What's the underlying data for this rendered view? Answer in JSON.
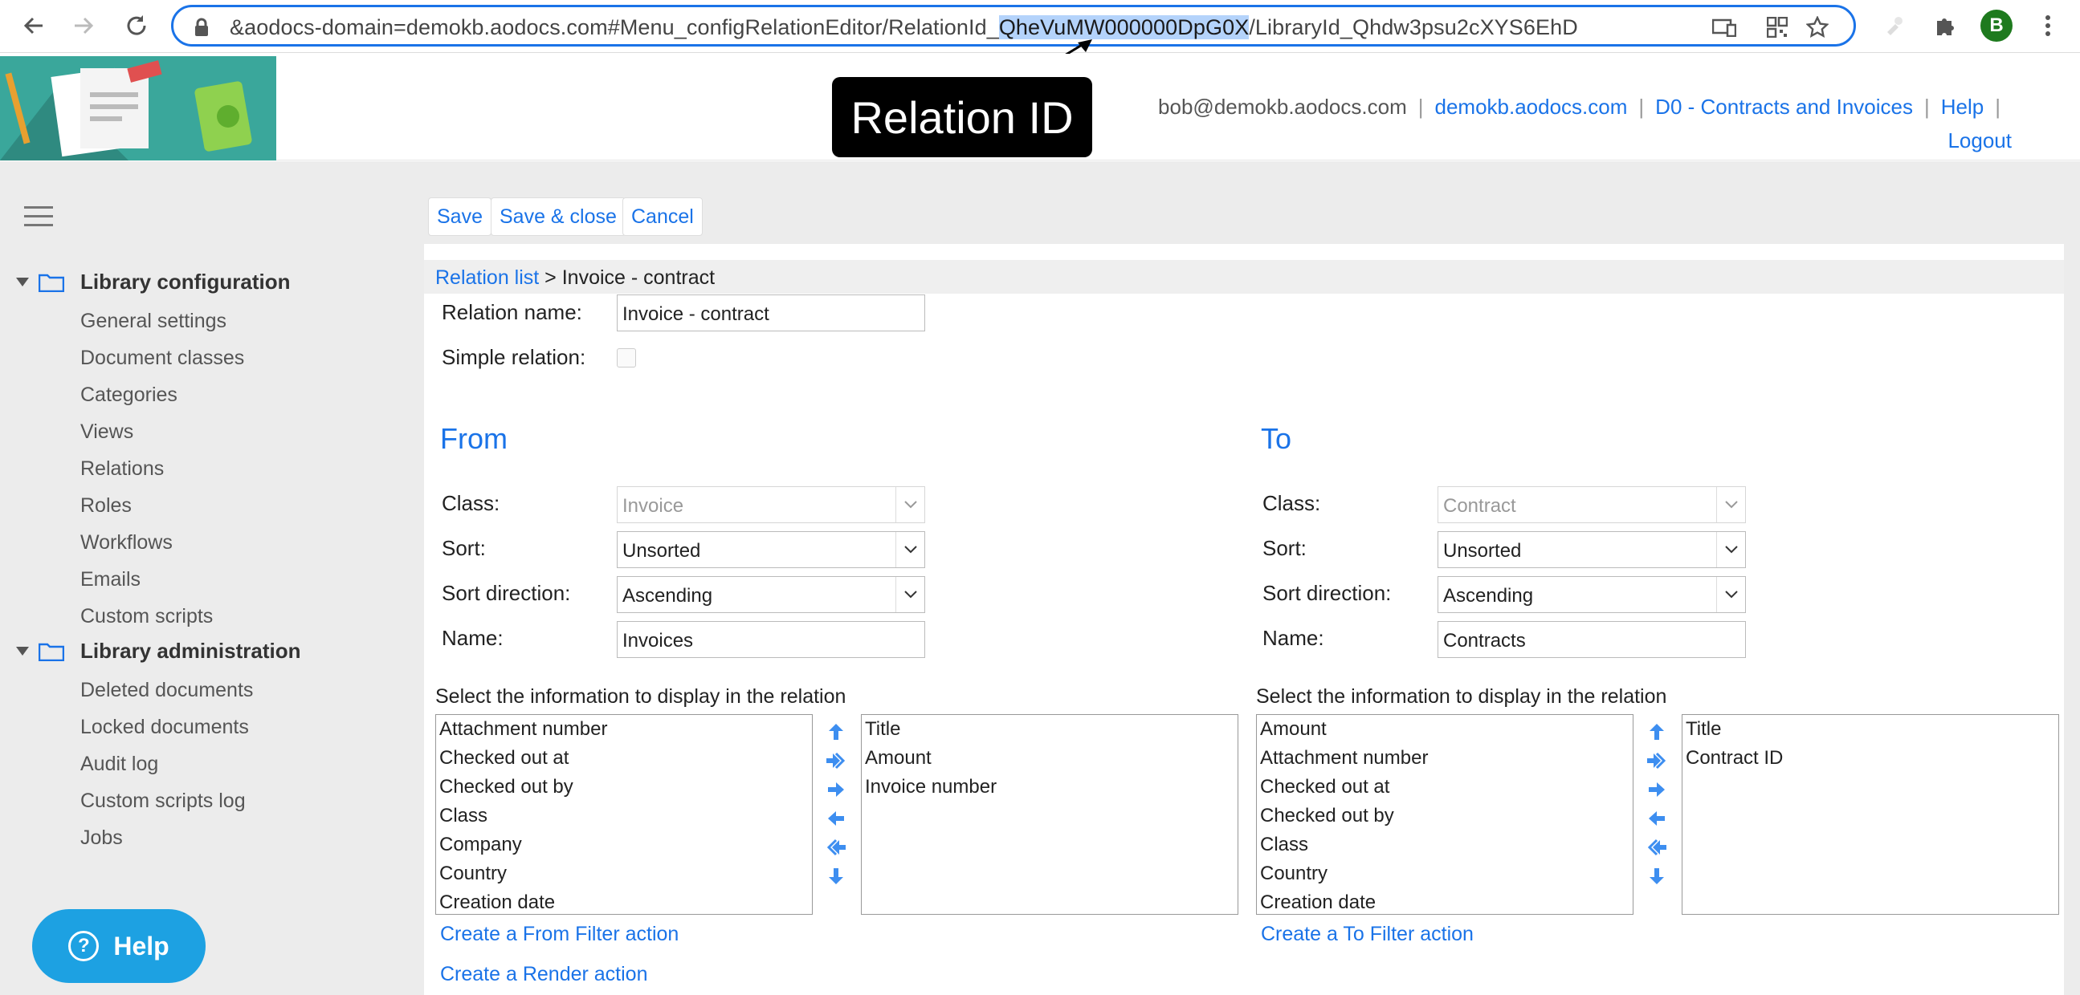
{
  "browser": {
    "url_prefix": "&aodocs-domain=demokb.aodocs.com#Menu_configRelationEditor/RelationId_",
    "url_highlight": "QheVuMW000000DpG0X",
    "url_suffix": "/LibraryId_Qhdw3psu2cXYS6EhD",
    "profile_initial": "B"
  },
  "annotation": "Relation ID",
  "header": {
    "user": "bob@demokb.aodocs.com",
    "links": [
      "demokb.aodocs.com",
      "D0 - Contracts and Invoices",
      "Help",
      "Logout"
    ]
  },
  "sidebar": {
    "sections": [
      {
        "title": "Library configuration",
        "items": [
          "General settings",
          "Document classes",
          "Categories",
          "Views",
          "Relations",
          "Roles",
          "Workflows",
          "Emails",
          "Custom scripts"
        ]
      },
      {
        "title": "Library administration",
        "items": [
          "Deleted documents",
          "Locked documents",
          "Audit log",
          "Custom scripts log",
          "Jobs"
        ]
      }
    ],
    "help_label": "Help"
  },
  "toolbar": {
    "save": "Save",
    "save_close": "Save & close",
    "cancel": "Cancel"
  },
  "breadcrumb": {
    "link": "Relation list",
    "current": " > Invoice - contract"
  },
  "form": {
    "relation_name_label": "Relation name:",
    "relation_name_value": "Invoice - contract",
    "simple_relation_label": "Simple relation:",
    "from": {
      "title": "From",
      "class_label": "Class:",
      "class_value": "Invoice",
      "sort_label": "Sort:",
      "sort_value": "Unsorted",
      "sort_dir_label": "Sort direction:",
      "sort_dir_value": "Ascending",
      "name_label": "Name:",
      "name_value": "Invoices",
      "select_info": "Select the information to display in the relation",
      "available": [
        "Attachment number",
        "Checked out at",
        "Checked out by",
        "Class",
        "Company",
        "Country",
        "Creation date"
      ],
      "selected": [
        "Title",
        "Amount",
        "Invoice number"
      ],
      "filter_action": "Create a From Filter action",
      "render_action": "Create a Render action"
    },
    "to": {
      "title": "To",
      "class_label": "Class:",
      "class_value": "Contract",
      "sort_label": "Sort:",
      "sort_value": "Unsorted",
      "sort_dir_label": "Sort direction:",
      "sort_dir_value": "Ascending",
      "name_label": "Name:",
      "name_value": "Contracts",
      "select_info": "Select the information to display in the relation",
      "available": [
        "Amount",
        "Attachment number",
        "Checked out at",
        "Checked out by",
        "Class",
        "Country",
        "Creation date"
      ],
      "selected": [
        "Title",
        "Contract ID"
      ],
      "filter_action": "Create a To Filter action"
    }
  },
  "colors": {
    "accent": "#1a73e8",
    "logo_bg": "#3aa79b",
    "help_button": "#1da1e2"
  }
}
